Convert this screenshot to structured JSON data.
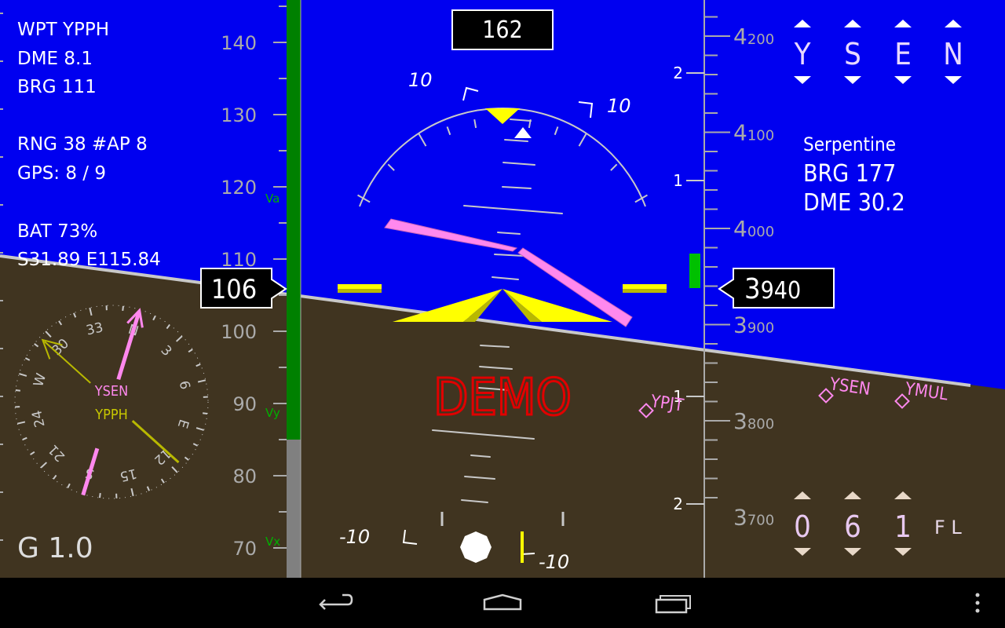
{
  "info_left": {
    "waypoint": "WPT YPPH",
    "dme": "DME 8.1",
    "bearing": "BRG  111",
    "range_ap": "RNG 38   #AP 8",
    "gps": "GPS: 8 / 9",
    "battery": "BAT  73%",
    "position": "S31.89 E115.84",
    "g_load": "G 1.0"
  },
  "heading": {
    "value": "162"
  },
  "airspeed": {
    "current": "106",
    "ticks": [
      "140",
      "130",
      "120",
      "110",
      "100",
      "90",
      "80",
      "70"
    ],
    "markers": {
      "va": "Va",
      "vy": "Vy",
      "vx": "Vx"
    }
  },
  "altitude": {
    "current_big": "3",
    "current_small": "940",
    "ticks": [
      {
        "big": "4",
        "small": "200"
      },
      {
        "big": "4",
        "small": "100"
      },
      {
        "big": "4",
        "small": "000"
      },
      {
        "big": "3",
        "small": "900"
      },
      {
        "big": "3",
        "small": "800"
      },
      {
        "big": "3",
        "small": "700"
      }
    ],
    "vsi_labels": [
      "2",
      "1",
      "1",
      "2"
    ]
  },
  "pitch_labels": {
    "up_left": "10",
    "up_right": "10",
    "down_left": "-10",
    "down_right": "-10"
  },
  "demo_label": "DEMO",
  "target_waypoint": {
    "letters": [
      "Y",
      "S",
      "E",
      "N"
    ],
    "name": "Serpentine",
    "bearing": "BRG  177",
    "dme": "DME 30.2"
  },
  "flight_level": {
    "digits": [
      "0",
      "6",
      "1"
    ],
    "unit": "F L"
  },
  "compass": {
    "labels": [
      "N",
      "3",
      "6",
      "E",
      "12",
      "15",
      "S",
      "21",
      "24",
      "W",
      "30",
      "33"
    ],
    "waypoint_1": "YSEN",
    "waypoint_2": "YPPH"
  },
  "horizon_waypoints": [
    "YPJT",
    "YSEN",
    "YMUL"
  ],
  "colors": {
    "sky": "#0000F0",
    "ground": "#403420",
    "magenta": "#FF88EE",
    "yellow": "#FFFF00",
    "speed_tape": "#008000",
    "demo": "#E00000"
  },
  "navigation": {
    "back": "back-icon",
    "home": "home-icon",
    "recents": "recents-icon",
    "menu": "overflow-menu-icon"
  }
}
